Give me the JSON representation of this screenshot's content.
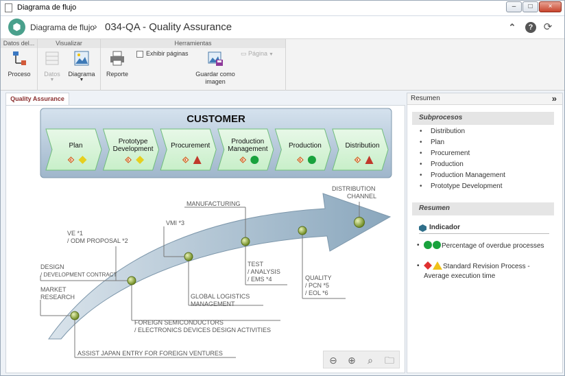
{
  "window": {
    "title": "Diagrama de flujo",
    "min": "–",
    "max": "□",
    "close": "×"
  },
  "header": {
    "app_name": "Diagrama de flujo",
    "separator": "›",
    "doc_title": "034-QA - Quality Assurance",
    "icons": [
      "collapse-up-icon",
      "help-icon",
      "refresh-icon"
    ],
    "help_glyph": "?",
    "collapse_glyph": "⌃",
    "refresh_glyph": "⟳"
  },
  "ribbon": {
    "groups": {
      "datos": "Datos del...",
      "visualizar": "Visualizar",
      "herramientas": "Herramientas"
    },
    "proceso": "Proceso",
    "datos": "Datos",
    "diagrama": "Diagrama",
    "reporte": "Reporte",
    "exhibir": "Exhibir páginas",
    "guardar": "Guardar como imagen",
    "pagina": "Página"
  },
  "tab": {
    "label": "Quality Assurance"
  },
  "diagram": {
    "customer_title": "CUSTOMER",
    "steps": [
      {
        "label": "Plan",
        "status": "diamond-yellow"
      },
      {
        "label": "Prototype Development",
        "status": "diamond-yellow"
      },
      {
        "label": "Procurement",
        "status": "triangle-red"
      },
      {
        "label": "Production Management",
        "status": "circle-green"
      },
      {
        "label": "Production",
        "status": "circle-green"
      },
      {
        "label": "Distribution",
        "status": "triangle-red"
      }
    ],
    "status_colors": {
      "diamond-yellow": "#e6cf1e",
      "triangle-red": "#c0392b",
      "circle-green": "#19a23d"
    },
    "annotations": {
      "distribution_channel": "DISTRIBUTION CHANNEL",
      "manufacturing": "MANUFACTURING",
      "vmi": "VMI *3",
      "ve": "VE *1 / ODM PROPOSAL *2",
      "design": "DESIGN / DEVELOPMENT CONTRACT",
      "market": "MARKET RESEARCH",
      "test": "TEST / ANALYSIS / EMS *4",
      "quality": "QUALITY / PCN *5 / EOL *6",
      "logistics": "GLOBAL LOGISTICS MANAGEMENT",
      "foreign": "FOREIGN SEMICONDUCTORS / ELECTRONICS DEVICES DESIGN ACTIVITIES",
      "assist": "ASSIST JAPAN ENTRY FOR FOREIGN VENTURES"
    }
  },
  "zoom_tools": [
    "zoom-out-icon",
    "zoom-in-icon",
    "zoom-fit-icon",
    "folder-search-icon"
  ],
  "panel": {
    "title": "Resumen",
    "collapse": "»",
    "subprocesses_title": "Subprocesos",
    "subprocesses": [
      "Distribution",
      "Plan",
      "Procurement",
      "Production",
      "Production Management",
      "Prototype Development"
    ],
    "summary_title": "Resumen",
    "indicator_title": "Indicador",
    "indicators": [
      {
        "label": "Percentage of overdue processes",
        "status": [
          "green",
          "green"
        ]
      },
      {
        "label": "Standard Revision Process - Average execution time",
        "status": [
          "red-diamond",
          "yellow-triangle"
        ]
      }
    ]
  }
}
